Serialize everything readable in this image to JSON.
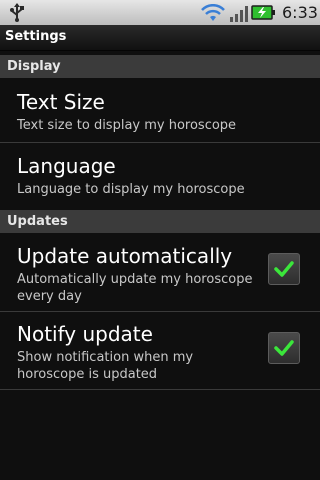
{
  "status_bar": {
    "time": "6:33",
    "icons": [
      "usb-icon",
      "wifi-icon",
      "signal-icon",
      "battery-charging-icon"
    ],
    "battery_color": "#2fbf2f"
  },
  "title_bar": {
    "title": "Settings"
  },
  "sections": {
    "display": "Display",
    "updates": "Updates"
  },
  "prefs": {
    "text_size": {
      "title": "Text Size",
      "summary": "Text size to display my horoscope"
    },
    "language": {
      "title": "Language",
      "summary": "Language to display my horoscope"
    },
    "update_auto": {
      "title": "Update automatically",
      "summary": "Automatically update my horoscope every day",
      "checked": true
    },
    "notify_update": {
      "title": "Notify update",
      "summary": "Show notification when my horoscope is updated",
      "checked": true
    }
  },
  "colors": {
    "check": "#3be63b",
    "section_bg": "#3b3b3b",
    "background": "#0f0f0f"
  }
}
